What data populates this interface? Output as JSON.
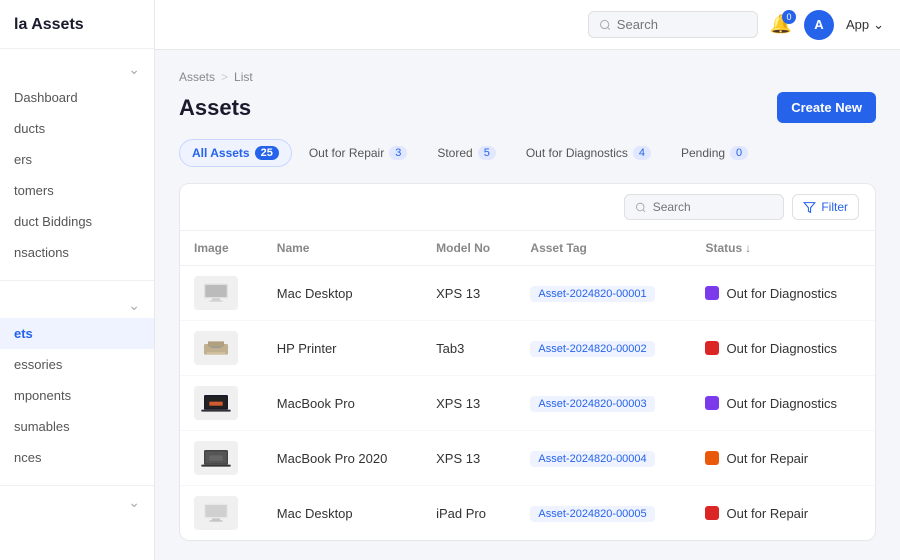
{
  "brand": "la Assets",
  "topbar": {
    "search_placeholder": "Search",
    "badge_count": "0",
    "avatar_initials": "A",
    "app_label": "App"
  },
  "sidebar": {
    "items": [
      {
        "id": "dashboard",
        "label": "Dashboard"
      },
      {
        "id": "products",
        "label": "ducts"
      },
      {
        "id": "users",
        "label": "ers"
      },
      {
        "id": "customers",
        "label": "tomers"
      },
      {
        "id": "product-biddings",
        "label": "duct Biddings"
      },
      {
        "id": "transactions",
        "label": "nsactions"
      }
    ],
    "items2": [
      {
        "id": "assets",
        "label": "ets",
        "active": true
      },
      {
        "id": "accessories",
        "label": "essories"
      },
      {
        "id": "components",
        "label": "mponents"
      },
      {
        "id": "consumables",
        "label": "sumables"
      },
      {
        "id": "licences",
        "label": "nces"
      }
    ]
  },
  "breadcrumb": {
    "parent": "Assets",
    "separator": ">",
    "current": "List"
  },
  "page": {
    "title": "Assets",
    "create_label": "Create New"
  },
  "tabs": [
    {
      "id": "all",
      "label": "All Assets",
      "count": "25",
      "active": true
    },
    {
      "id": "repair",
      "label": "Out for Repair",
      "count": "3",
      "active": false
    },
    {
      "id": "stored",
      "label": "Stored",
      "count": "5",
      "active": false
    },
    {
      "id": "diagnostics",
      "label": "Out for Diagnostics",
      "count": "4",
      "active": false
    },
    {
      "id": "pending",
      "label": "Pending",
      "count": "0",
      "active": false
    }
  ],
  "table": {
    "filter_label": "Filter",
    "search_placeholder": "Search",
    "columns": [
      "Image",
      "Name",
      "Model No",
      "Asset Tag",
      "Status"
    ],
    "rows": [
      {
        "id": 1,
        "img_type": "desktop",
        "name": "Mac Desktop",
        "model": "XPS 13",
        "tag": "Asset-2024820-00001",
        "status": "Out for Diagnostics",
        "status_color": "dot-purple"
      },
      {
        "id": 2,
        "img_type": "printer",
        "name": "HP Printer",
        "model": "Tab3",
        "tag": "Asset-2024820-00002",
        "status": "Out for Diagnostics",
        "status_color": "dot-red"
      },
      {
        "id": 3,
        "img_type": "laptop",
        "name": "MacBook Pro",
        "model": "XPS 13",
        "tag": "Asset-2024820-00003",
        "status": "Out for Diagnostics",
        "status_color": "dot-purple"
      },
      {
        "id": 4,
        "img_type": "laptop2",
        "name": "MacBook Pro 2020",
        "model": "XPS 13",
        "tag": "Asset-2024820-00004",
        "status": "Out for Repair",
        "status_color": "dot-orange"
      },
      {
        "id": 5,
        "img_type": "desktop2",
        "name": "Mac Desktop",
        "model": "iPad Pro",
        "tag": "Asset-2024820-00005",
        "status": "Out for Repair",
        "status_color": "dot-red"
      }
    ]
  }
}
